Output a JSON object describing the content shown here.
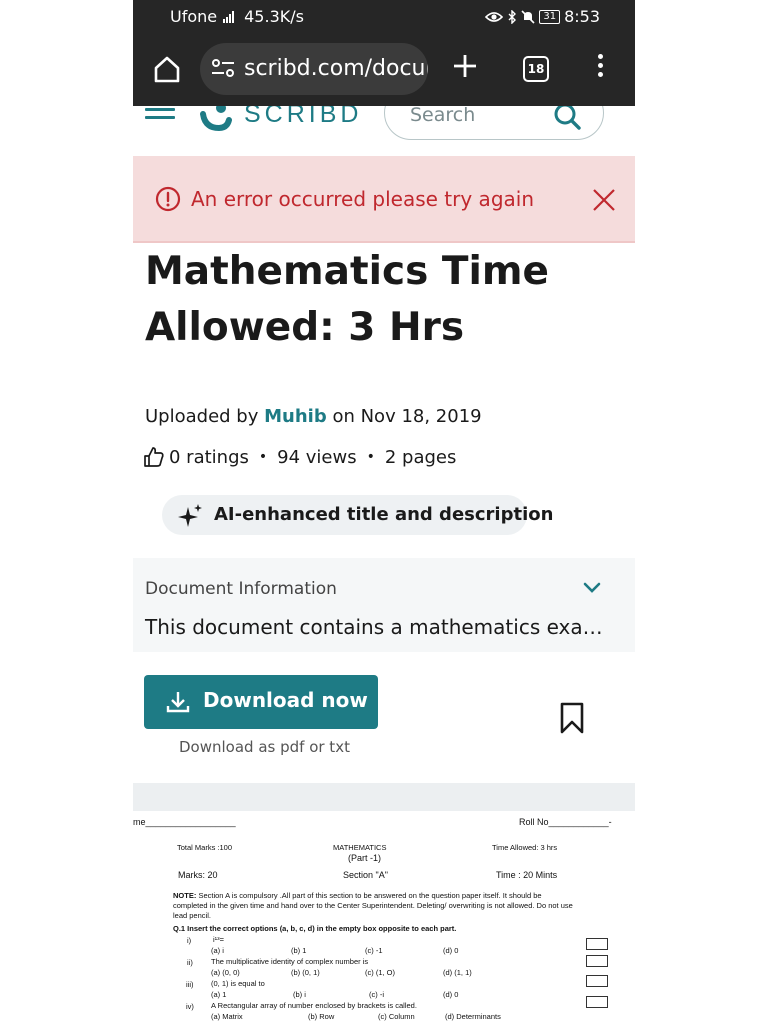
{
  "status_bar": {
    "carrier": "Ufone",
    "network": "4G",
    "speed": "45.3K/s",
    "battery": "31",
    "time": "8:53"
  },
  "browser": {
    "url": "scribd.com/docur",
    "tab_count": "18"
  },
  "header": {
    "logo_text": "SCRIBD",
    "search_placeholder": "Search"
  },
  "error": {
    "message": "An error occurred please try again"
  },
  "document": {
    "title": "Mathematics Time Allowed: 3 Hrs",
    "uploaded_prefix": "Uploaded by",
    "author": "Muhib",
    "uploaded_suffix": "on Nov 18, 2019",
    "ratings": "0 ratings",
    "views": "94 views",
    "pages": "2 pages",
    "separator": "•",
    "ai_label": "AI-enhanced title and description"
  },
  "doc_info": {
    "heading": "Document Information",
    "description": "This document contains a mathematics exa…"
  },
  "download": {
    "button_label": "Download now",
    "sub_label": "Download as pdf or txt"
  },
  "preview": {
    "name_label": "me__________________",
    "roll_label": "Roll No____________-",
    "total_marks": "Total Marks :100",
    "subject": "MATHEMATICS",
    "part": "(Part -1)",
    "time_allowed": "Time Allowed: 3 hrs",
    "marks": "Marks: 20",
    "section": "Section \"A\"",
    "time_mints": "Time : 20 Mints",
    "note_label": "NOTE:",
    "note": "Section A is compulsory .All part of this section to be answered on the question paper itself. It should be completed in the given time and hand over to the Center Superintendent. Deleting/ overwriting is not allowed. Do not use lead pencil.",
    "q1": "Q.1 Insert the correct options (a, b, c, d) in the empty box opposite to each part.",
    "questions": [
      {
        "num": "i)",
        "text": "i¹³=",
        "a": "(a) i",
        "b": "(b) 1",
        "c": "(c) -1",
        "d": "(d) 0"
      },
      {
        "num": "ii)",
        "text": "The multiplicative identity of complex number is",
        "a": "(a) (0, 0)",
        "b": "(b) (0, 1)",
        "c": "(c) (1, O)",
        "d": "(d) (1, 1)"
      },
      {
        "num": "iii)",
        "text": "(0, 1) is equal to",
        "a": "(a) 1",
        "b": "(b) i",
        "c": "(c) -i",
        "d": "(d) 0"
      },
      {
        "num": "iv)",
        "text": "A Rectangular array of number enclosed by brackets is called.",
        "a": "(a) Matrix",
        "b": "(b) Row",
        "c": "(c) Column",
        "d": "(d) Determinants"
      }
    ]
  },
  "colors": {
    "brand": "#1e7b85",
    "error_bg": "#f5dcdc",
    "error_text": "#c0282e",
    "chrome_bg": "#262626"
  }
}
